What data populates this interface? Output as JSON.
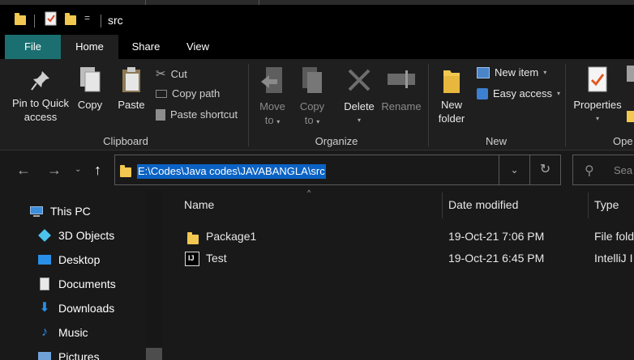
{
  "titlebar": {
    "title": "src",
    "qa_dropdown": "="
  },
  "ribbon_tabs": [
    {
      "label": "File"
    },
    {
      "label": "Home"
    },
    {
      "label": "Share"
    },
    {
      "label": "View"
    }
  ],
  "ribbon": {
    "clipboard": {
      "pin": "Pin to Quick",
      "pin2": "access",
      "copy": "Copy",
      "paste": "Paste",
      "cut": "Cut",
      "copy_path": "Copy path",
      "paste_shortcut": "Paste shortcut",
      "label": "Clipboard"
    },
    "organize": {
      "move_to": "Move",
      "move_to2": "to",
      "copy_to": "Copy",
      "copy_to2": "to",
      "delete": "Delete",
      "rename": "Rename",
      "label": "Organize"
    },
    "new": {
      "new_folder": "New",
      "new_folder2": "folder",
      "new_item": "New item",
      "easy_access": "Easy access",
      "label": "New"
    },
    "open": {
      "properties": "Properties",
      "label": "Ope"
    }
  },
  "address": {
    "path": "E:\\Codes\\Java codes\\JAVABANGLA\\src",
    "search_placeholder": "Sea"
  },
  "nav": {
    "items": [
      {
        "label": "This PC"
      },
      {
        "label": "3D Objects"
      },
      {
        "label": "Desktop"
      },
      {
        "label": "Documents"
      },
      {
        "label": "Downloads"
      },
      {
        "label": "Music"
      },
      {
        "label": "Pictures"
      }
    ]
  },
  "files": {
    "columns": {
      "name": "Name",
      "date": "Date modified",
      "type": "Type"
    },
    "rows": [
      {
        "name": "Package1",
        "date": "19-Oct-21 7:06 PM",
        "type": "File fold"
      },
      {
        "name": "Test",
        "date": "19-Oct-21 6:45 PM",
        "type": "IntelliJ I"
      }
    ]
  },
  "colors": {
    "file_tab": "#1b6f70",
    "selection": "#0a62c4",
    "folder": "#f3c850"
  }
}
